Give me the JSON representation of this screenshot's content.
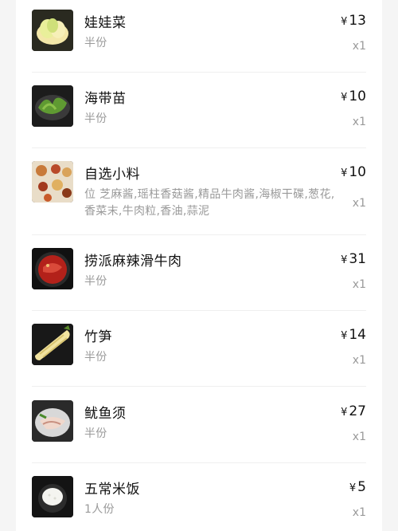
{
  "currency_symbol": "¥",
  "items": [
    {
      "name": "娃娃菜",
      "detail": "半份",
      "price": "13",
      "qty": "x1",
      "icon": "baby-cabbage-icon"
    },
    {
      "name": "海带苗",
      "detail": "半份",
      "price": "10",
      "qty": "x1",
      "icon": "kelp-sprouts-icon"
    },
    {
      "name": "自选小料",
      "detail": "位 芝麻酱,瑶柱香菇酱,精品牛肉酱,海椒干碟,葱花,香菜末,牛肉粒,香油,蒜泥",
      "price": "10",
      "qty": "x1",
      "icon": "sauce-bar-icon"
    },
    {
      "name": "捞派麻辣滑牛肉",
      "detail": "半份",
      "price": "31",
      "qty": "x1",
      "icon": "spicy-beef-icon"
    },
    {
      "name": "竹笋",
      "detail": "半份",
      "price": "14",
      "qty": "x1",
      "icon": "bamboo-shoot-icon"
    },
    {
      "name": "鱿鱼须",
      "detail": "半份",
      "price": "27",
      "qty": "x1",
      "icon": "squid-tentacles-icon"
    },
    {
      "name": "五常米饭",
      "detail": "1人份",
      "price": "5",
      "qty": "x1",
      "icon": "rice-bowl-icon"
    }
  ]
}
